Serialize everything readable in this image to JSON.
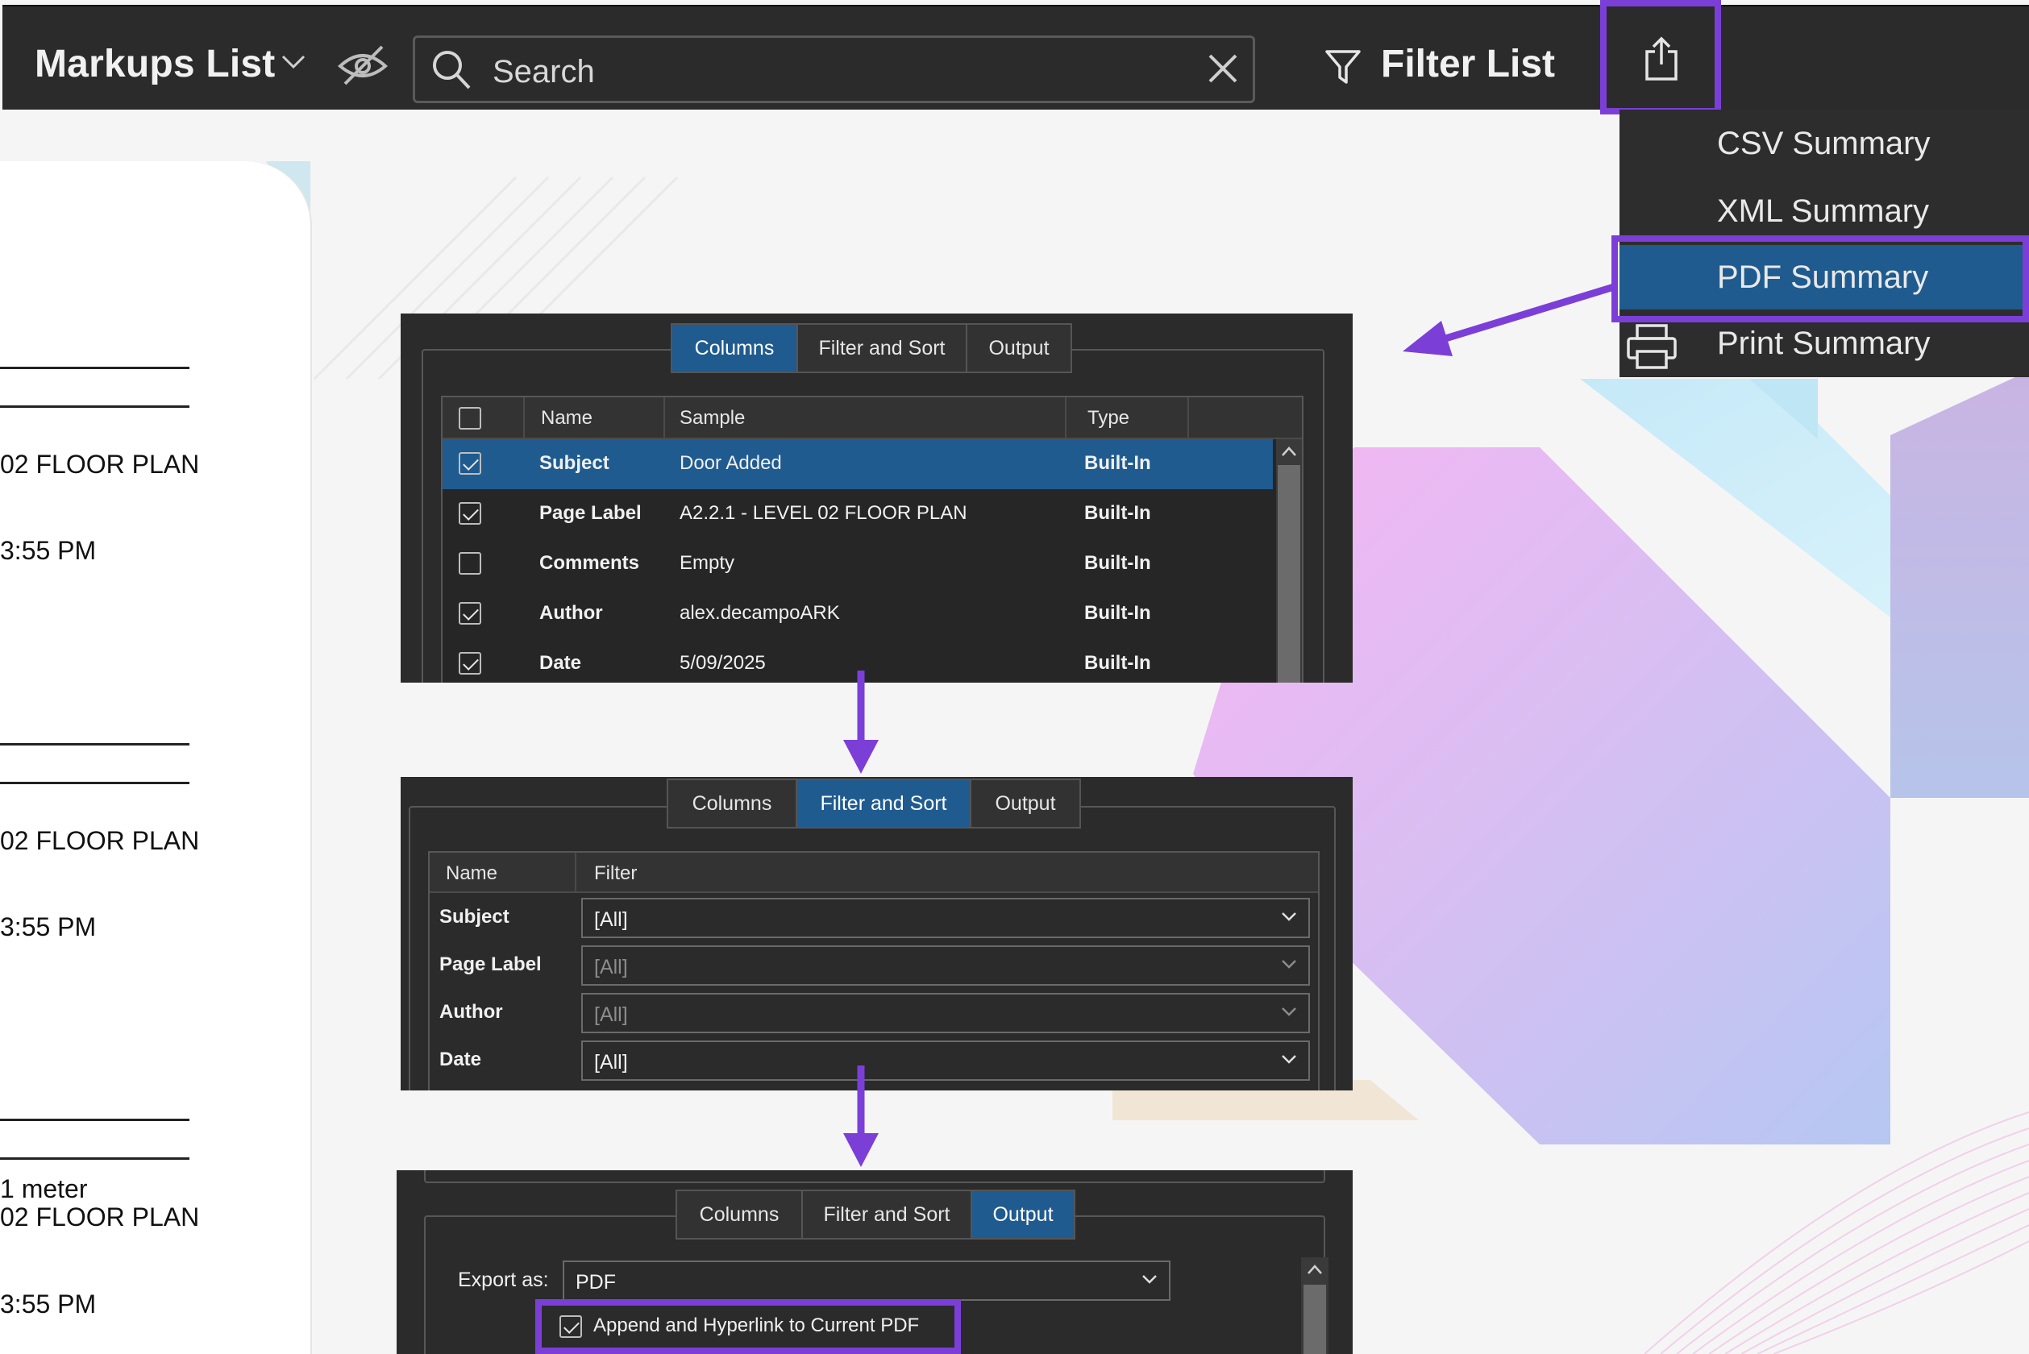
{
  "toolbar": {
    "title": "Markups List",
    "search_placeholder": "Search",
    "filter_label": "Filter List"
  },
  "export_menu": {
    "items": [
      {
        "label": "CSV Summary"
      },
      {
        "label": "XML Summary"
      },
      {
        "label": "PDF Summary",
        "highlighted": true
      },
      {
        "label": "Print Summary"
      }
    ]
  },
  "document_preview": {
    "lines": [
      "02 FLOOR PLAN",
      "3:55 PM",
      "02 FLOOR PLAN",
      "3:55 PM",
      "1 meter",
      "02 FLOOR PLAN",
      "3:55 PM"
    ]
  },
  "tabs": [
    "Columns",
    "Filter and Sort",
    "Output"
  ],
  "columns_panel": {
    "headers": [
      "Name",
      "Sample",
      "Type"
    ],
    "rows": [
      {
        "name": "Subject",
        "sample": "Door Added",
        "type": "Built-In",
        "checked": true,
        "selected": true
      },
      {
        "name": "Page Label",
        "sample": "A2.2.1 - LEVEL 02 FLOOR PLAN",
        "type": "Built-In",
        "checked": true
      },
      {
        "name": "Comments",
        "sample": "Empty",
        "type": "Built-In",
        "checked": false
      },
      {
        "name": "Author",
        "sample": "alex.decampoARK",
        "type": "Built-In",
        "checked": true
      },
      {
        "name": "Date",
        "sample": "5/09/2025",
        "type": "Built-In",
        "checked": true
      }
    ]
  },
  "filter_panel": {
    "headers": [
      "Name",
      "Filter"
    ],
    "rows": [
      {
        "name": "Subject",
        "value": "[All]",
        "enabled": true
      },
      {
        "name": "Page Label",
        "value": "[All]",
        "enabled": false
      },
      {
        "name": "Author",
        "value": "[All]",
        "enabled": false
      },
      {
        "name": "Date",
        "value": "[All]",
        "enabled": true
      }
    ]
  },
  "output_panel": {
    "export_label": "Export as:",
    "export_value": "PDF",
    "append_label": "Append and Hyperlink to Current PDF",
    "append_checked": true
  },
  "colors": {
    "accent_highlight": "#7b3fd8",
    "selection_blue": "#1f5b8f",
    "panel_bg": "#2b2b2b"
  }
}
